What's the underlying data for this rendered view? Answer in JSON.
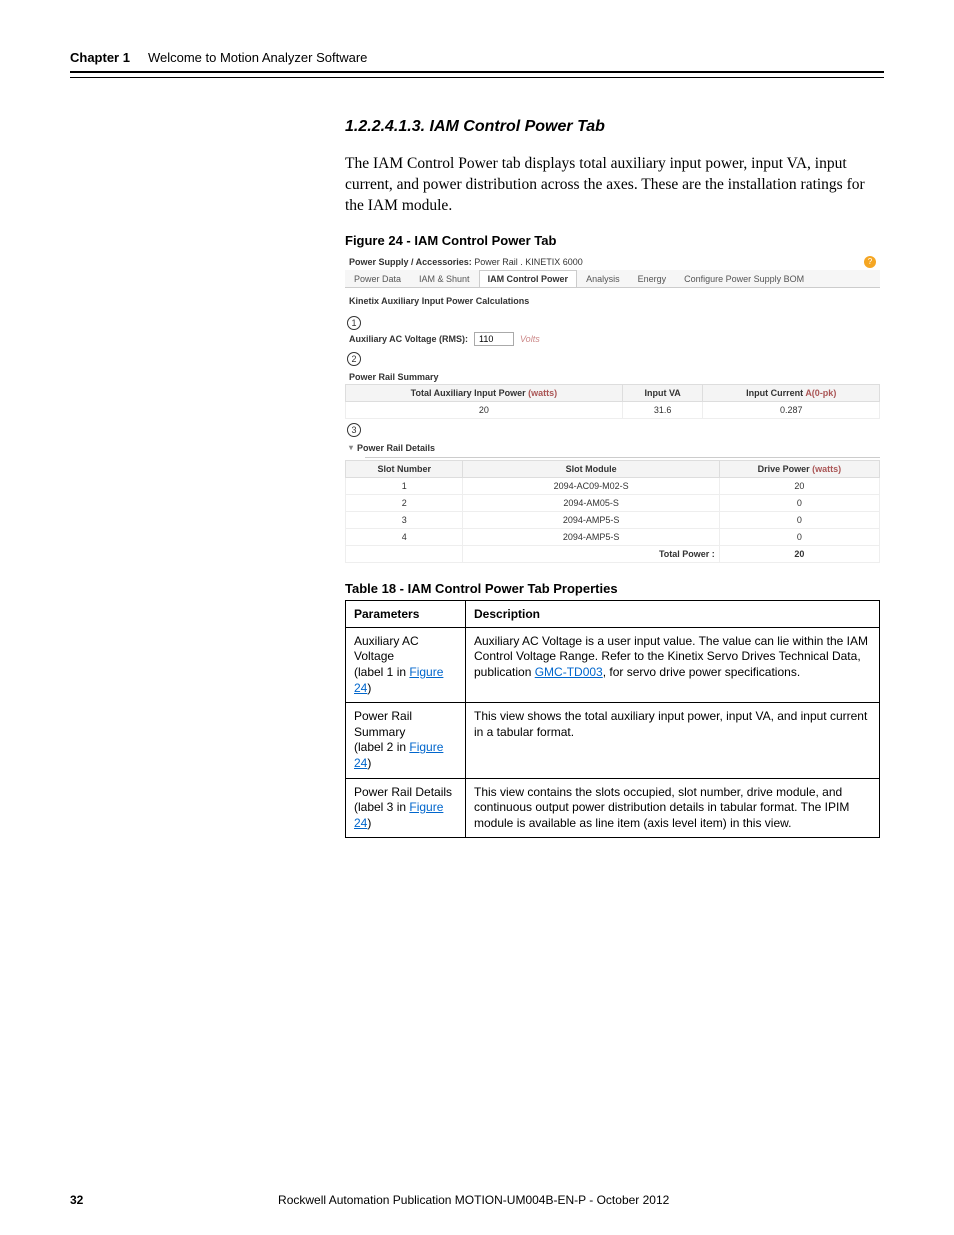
{
  "header": {
    "chapter_label": "Chapter 1",
    "chapter_title": "Welcome to Motion Analyzer Software"
  },
  "section": {
    "number_title": "1.2.2.4.1.3.   IAM Control Power Tab",
    "body": "The IAM Control Power tab displays total auxiliary input power, input VA, input current, and power distribution across the axes. These are the installation ratings for the IAM module.",
    "figure_caption": "Figure 24 - IAM Control Power Tab"
  },
  "screenshot": {
    "title_prefix": "Power Supply / Accessories:",
    "title_value": "Power Rail . KINETIX 6000",
    "help_icon": "?",
    "tabs": [
      "Power Data",
      "IAM & Shunt",
      "IAM Control Power",
      "Analysis",
      "Energy",
      "Configure Power Supply BOM"
    ],
    "active_tab_index": 2,
    "calc_title": "Kinetix Auxiliary Input Power Calculations",
    "callout1": "1",
    "aux_label": "Auxiliary AC Voltage (RMS):",
    "aux_value": "110",
    "aux_unit": "Volts",
    "callout2": "2",
    "summary_title": "Power Rail Summary",
    "summary_headers": {
      "c1a": "Total Auxiliary Input Power ",
      "c1b": "(watts)",
      "c2": "Input VA",
      "c3a": "Input Current ",
      "c3b": "A(0-pk)"
    },
    "summary_row": {
      "c1": "20",
      "c2": "31.6",
      "c3": "0.287"
    },
    "callout3": "3",
    "details_title": "Power Rail Details",
    "details_headers": {
      "c1": "Slot Number",
      "c2": "Slot Module",
      "c3a": "Drive Power ",
      "c3b": "(watts)"
    },
    "details_rows": [
      {
        "c1": "1",
        "c2": "2094-AC09-M02-S",
        "c3": "20"
      },
      {
        "c1": "2",
        "c2": "2094-AM05-S",
        "c3": "0"
      },
      {
        "c1": "3",
        "c2": "2094-AMP5-S",
        "c3": "0"
      },
      {
        "c1": "4",
        "c2": "2094-AMP5-S",
        "c3": "0"
      }
    ],
    "total_label": "Total Power :",
    "total_value": "20"
  },
  "properties_table": {
    "caption": "Table 18 - IAM Control Power Tab Properties",
    "head_param": "Parameters",
    "head_desc": "Description",
    "rows": [
      {
        "param_line1": "Auxiliary AC Voltage",
        "param_line2_pre": "(label 1 in ",
        "param_link": "Figure 24",
        "param_line2_post": ")",
        "desc_pre": "Auxiliary AC Voltage is a user input value. The value can lie within the IAM Control Voltage Range. Refer to the Kinetix Servo Drives Technical Data, publication ",
        "desc_link": "GMC-TD003",
        "desc_post": ", for servo drive power specifications."
      },
      {
        "param_line1": "Power Rail Summary",
        "param_line2_pre": "(label 2 in ",
        "param_link": "Figure 24",
        "param_line2_post": ")",
        "desc_pre": "This view shows the total auxiliary input power, input VA, and input current in a tabular format.",
        "desc_link": "",
        "desc_post": ""
      },
      {
        "param_line1": "Power Rail Details",
        "param_line2_pre": "(label 3 in ",
        "param_link": "Figure 24",
        "param_line2_post": ")",
        "desc_pre": "This view contains the slots occupied, slot number, drive module, and continuous output power distribution details in tabular format. The IPIM module is available as line item (axis level item) in this view.",
        "desc_link": "",
        "desc_post": ""
      }
    ]
  },
  "footer": {
    "page": "32",
    "pub": "Rockwell Automation Publication MOTION-UM004B-EN-P - October 2012"
  }
}
